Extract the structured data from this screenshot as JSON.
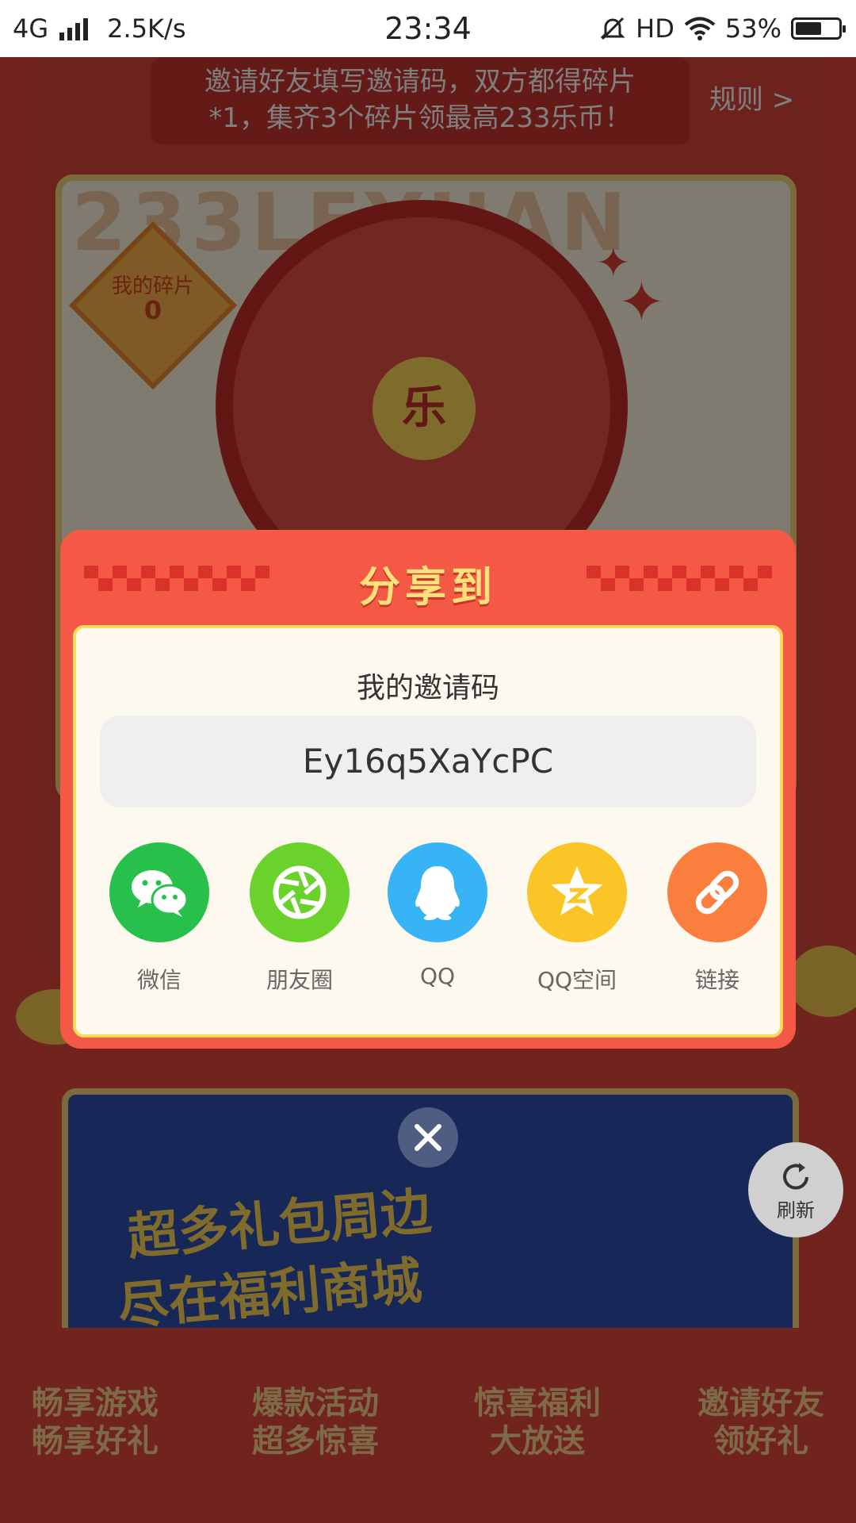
{
  "status_bar": {
    "network": "4G",
    "speed": "2.5K/s",
    "time": "23:34",
    "hd": "HD",
    "battery": "53%"
  },
  "background_page": {
    "invite_text_line1": "邀请好友填写邀请码，双方都得碎片",
    "invite_text_line2": "*1，集齐3个碎片领最高233乐币！",
    "rules_link": "规则 >",
    "watermark": "233LEYUAN",
    "my_fragments_label": "我的碎片",
    "my_fragments_count": "0",
    "wheel_center": "乐",
    "banner_line1": "超多礼包周边",
    "banner_line2": "尽在福利商城",
    "tabs": [
      {
        "line1": "畅享游戏",
        "line2": "畅享好礼"
      },
      {
        "line1": "爆款活动",
        "line2": "超多惊喜"
      },
      {
        "line1": "惊喜福利",
        "line2": "大放送"
      },
      {
        "line1": "邀请好友",
        "line2": "领好礼"
      }
    ]
  },
  "dialog": {
    "title": "分享到",
    "subtitle": "我的邀请码",
    "invite_code": "Ey16q5XaYcPC",
    "share_options": [
      {
        "label": "微信",
        "icon": "wechat-icon",
        "color": "#27c04a"
      },
      {
        "label": "朋友圈",
        "icon": "moments-icon",
        "color": "#6bd22c"
      },
      {
        "label": "QQ",
        "icon": "qq-icon",
        "color": "#37b4f5"
      },
      {
        "label": "QQ空间",
        "icon": "qzone-icon",
        "color": "#fbc528"
      },
      {
        "label": "链接",
        "icon": "link-icon",
        "color": "#fa7e3d"
      }
    ]
  },
  "refresh_label": "刷新"
}
